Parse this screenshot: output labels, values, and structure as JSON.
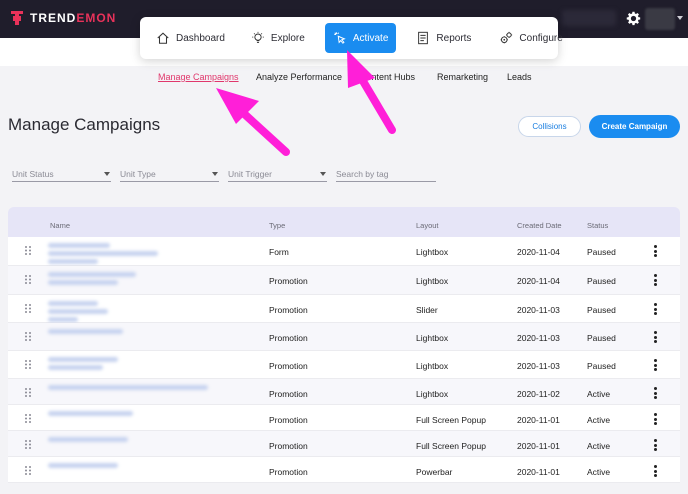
{
  "brand": {
    "name_prefix": "TREND",
    "name_accent": "EMON",
    "accent_color": "#e8325a"
  },
  "main_nav": [
    {
      "label": "Dashboard",
      "icon": "home-icon"
    },
    {
      "label": "Explore",
      "icon": "lightbulb-icon"
    },
    {
      "label": "Activate",
      "icon": "cursor-click-icon",
      "active": true
    },
    {
      "label": "Reports",
      "icon": "report-icon"
    },
    {
      "label": "Configure",
      "icon": "gears-icon"
    }
  ],
  "subnav": [
    {
      "label": "Manage Campaigns",
      "current": true
    },
    {
      "label": "Analyze Performance"
    },
    {
      "label": "Content Hubs"
    },
    {
      "label": "Remarketing"
    },
    {
      "label": "Leads"
    }
  ],
  "page": {
    "title": "Manage Campaigns",
    "collisions_label": "Collisions",
    "create_label": "Create Campaign"
  },
  "filters": {
    "unit_status": "Unit Status",
    "unit_type": "Unit Type",
    "unit_trigger": "Unit Trigger",
    "search_placeholder": "Search by tag"
  },
  "table": {
    "headers": {
      "name": "Name",
      "type": "Type",
      "layout": "Layout",
      "created": "Created Date",
      "status": "Status"
    },
    "rows": [
      {
        "type": "Form",
        "layout": "Lightbox",
        "created": "2020-11-04",
        "status": "Paused"
      },
      {
        "type": "Promotion",
        "layout": "Lightbox",
        "created": "2020-11-04",
        "status": "Paused"
      },
      {
        "type": "Promotion",
        "layout": "Slider",
        "created": "2020-11-03",
        "status": "Paused"
      },
      {
        "type": "Promotion",
        "layout": "Lightbox",
        "created": "2020-11-03",
        "status": "Paused"
      },
      {
        "type": "Promotion",
        "layout": "Lightbox",
        "created": "2020-11-03",
        "status": "Paused"
      },
      {
        "type": "Promotion",
        "layout": "Lightbox",
        "created": "2020-11-02",
        "status": "Active"
      },
      {
        "type": "Promotion",
        "layout": "Full Screen Popup",
        "created": "2020-11-01",
        "status": "Active"
      },
      {
        "type": "Promotion",
        "layout": "Full Screen Popup",
        "created": "2020-11-01",
        "status": "Active"
      },
      {
        "type": "Promotion",
        "layout": "Powerbar",
        "created": "2020-11-01",
        "status": "Active"
      }
    ]
  },
  "colors": {
    "primary": "#1a8cf0",
    "annotation_arrow": "#ff1fd8",
    "header_bg": "#e6e5f7"
  }
}
